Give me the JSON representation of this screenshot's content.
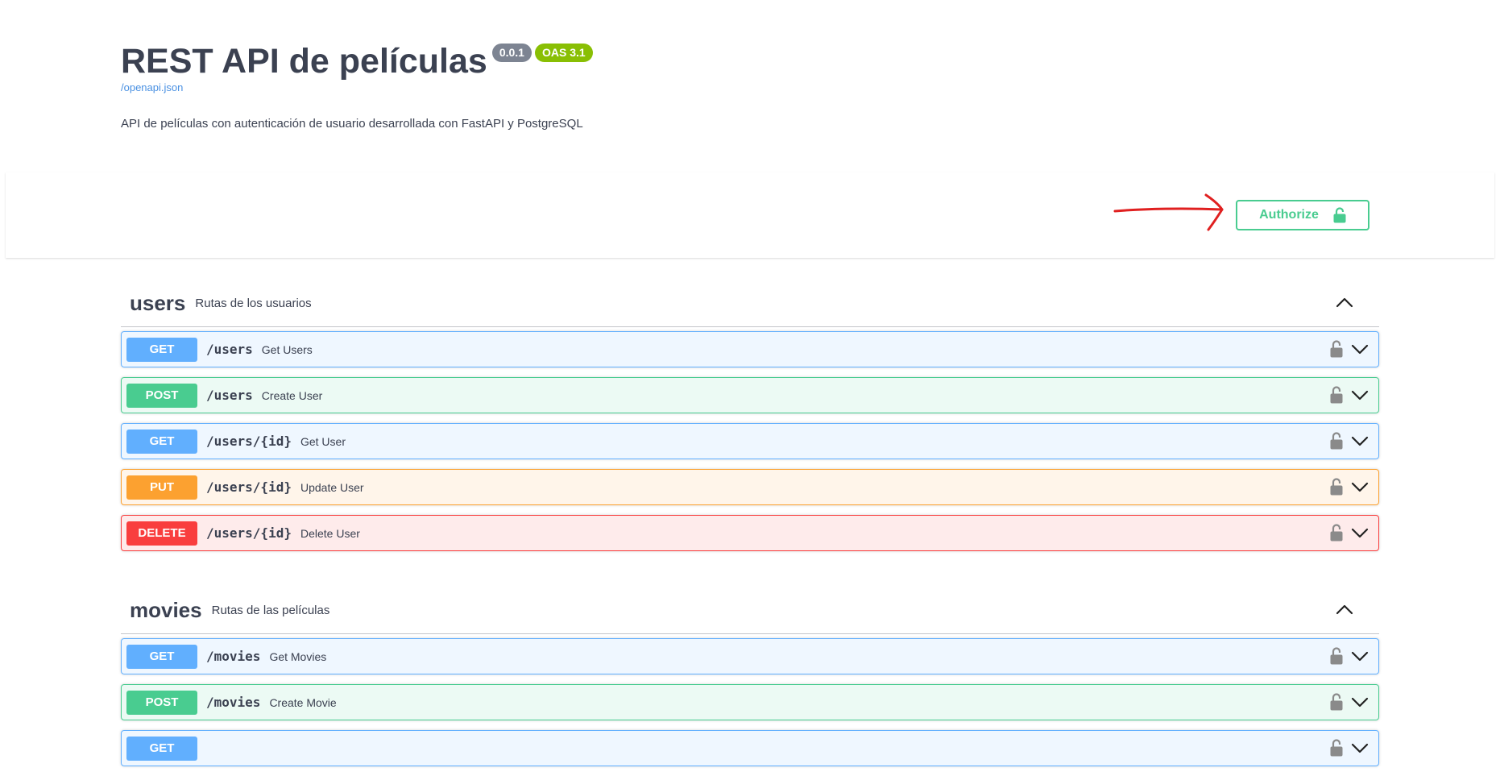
{
  "info": {
    "title": "REST API de películas",
    "version": "0.0.1",
    "oas": "OAS 3.1",
    "spec_link": "/openapi.json",
    "description": "API de películas con autenticación de usuario desarrollada con FastAPI y PostgreSQL"
  },
  "authorize": {
    "label": "Authorize",
    "icon": "unlocked-lock-icon"
  },
  "colors": {
    "get": "#61affe",
    "post": "#49cc90",
    "put": "#fca130",
    "delete": "#f93e3e",
    "annotation": "#e02020"
  },
  "tags": [
    {
      "name": "users",
      "description": "Rutas de los usuarios",
      "operations": [
        {
          "method": "GET",
          "path": "/users",
          "summary": "Get Users"
        },
        {
          "method": "POST",
          "path": "/users",
          "summary": "Create User"
        },
        {
          "method": "GET",
          "path": "/users/{id}",
          "summary": "Get User"
        },
        {
          "method": "PUT",
          "path": "/users/{id}",
          "summary": "Update User"
        },
        {
          "method": "DELETE",
          "path": "/users/{id}",
          "summary": "Delete User"
        }
      ]
    },
    {
      "name": "movies",
      "description": "Rutas de las películas",
      "operations": [
        {
          "method": "GET",
          "path": "/movies",
          "summary": "Get Movies"
        },
        {
          "method": "POST",
          "path": "/movies",
          "summary": "Create Movie"
        },
        {
          "method": "GET",
          "path": "",
          "summary": ""
        }
      ]
    }
  ]
}
